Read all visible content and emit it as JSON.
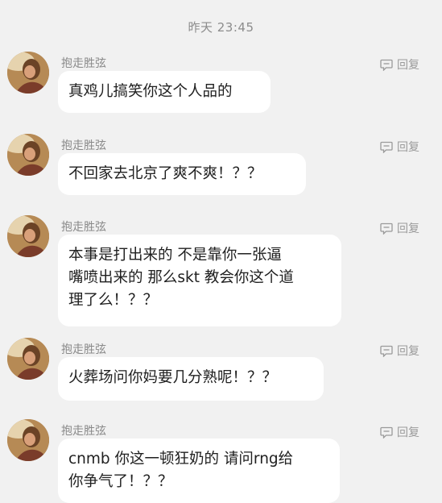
{
  "timestamp": "昨天 23:45",
  "reply_label": "回复",
  "messages": [
    {
      "sender": "抱走胜弦",
      "text": "真鸡儿搞笑你这个人品的"
    },
    {
      "sender": "抱走胜弦",
      "text": "不回家去北京了爽不爽！？？"
    },
    {
      "sender": "抱走胜弦",
      "lines": [
        "本事是打出来的 不是靠你一张逼",
        "嘴喷出来的 那么skt 教会你这个道",
        "理了么！？？"
      ]
    },
    {
      "sender": "抱走胜弦",
      "text": "火葬场问你妈要几分熟呢！？？"
    },
    {
      "sender": "抱走胜弦",
      "lines": [
        "cnmb 你这一顿狂奶的 请问rng给",
        "你争气了！？？"
      ]
    }
  ]
}
